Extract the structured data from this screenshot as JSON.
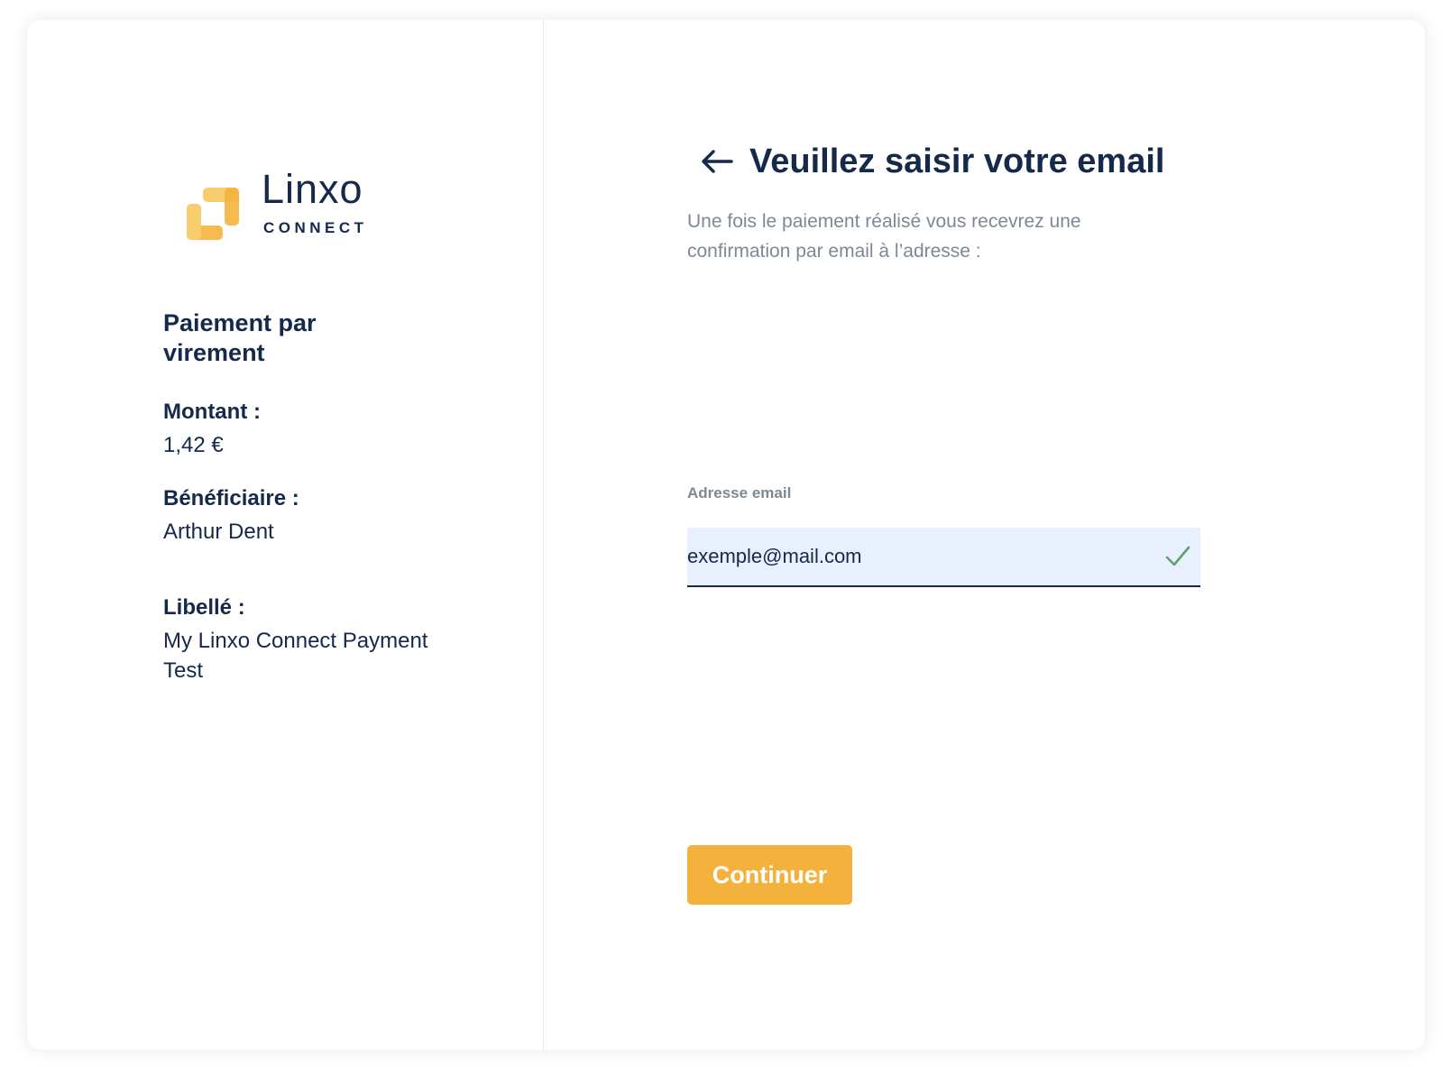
{
  "brand": {
    "name": "Linxo",
    "sub": "CONNECT",
    "colors": {
      "primary_dark": "#15294b",
      "accent_yellow": "#f4b23d",
      "field_bg": "#e8f0fe",
      "success_green": "#5aa469"
    }
  },
  "summary": {
    "title": "Paiement par virement",
    "amount_label": "Montant :",
    "amount_value": "1,42 €",
    "beneficiary_label": "Bénéficiaire :",
    "beneficiary_value": "Arthur Dent",
    "libelle_label": "Libellé :",
    "libelle_value": "My Linxo Connect Payment Test"
  },
  "form": {
    "back_icon": "arrow-left-icon",
    "title": "Veuillez saisir votre email",
    "subtitle": "Une fois le paiement réalisé vous recevrez une confirmation par email à l’adresse :",
    "email_label": "Adresse email",
    "email_value": "exemple@mail.com",
    "valid_icon": "checkmark-icon",
    "submit_label": "Continuer"
  }
}
